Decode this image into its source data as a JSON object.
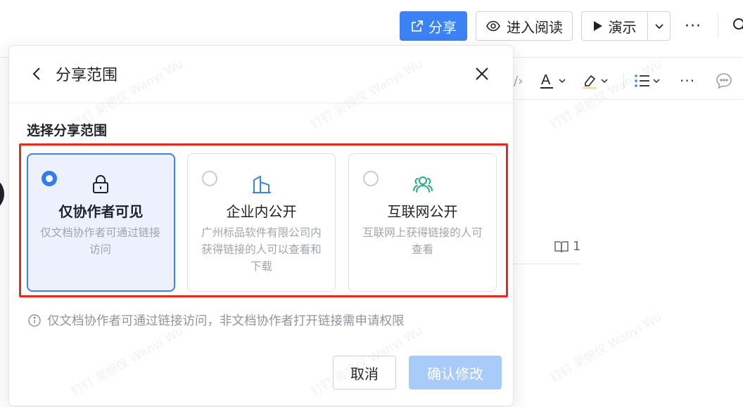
{
  "topbar": {
    "share_label": "分享",
    "read_label": "进入阅读",
    "present_label": "演示",
    "more_label": "···"
  },
  "format_toolbar": {
    "code_label": "/›",
    "font_color_letter": "A",
    "more_label": "···"
  },
  "doc_peek": {
    "book_count": "1"
  },
  "dialog": {
    "title": "分享范围",
    "section_label": "选择分享范围",
    "options": [
      {
        "title": "仅协作者可见",
        "description": "仅文档协作者可通过链接访问",
        "icon": "lock-icon",
        "selected": true
      },
      {
        "title": "企业内公开",
        "description": "广州标品软件有限公司内获得链接的人可以查看和下载",
        "icon": "building-icon",
        "selected": false
      },
      {
        "title": "互联网公开",
        "description": "互联网上获得链接的人可查看",
        "icon": "users-icon",
        "selected": false
      }
    ],
    "info_text": "仅文档协作者可通过链接访问，非文档协作者打开链接需申请权限",
    "cancel_label": "取消",
    "confirm_label": "确认修改"
  },
  "watermark_text": "钉钉 吴婉仪 Wanyi Wu",
  "colors": {
    "primary": "#3b82f6",
    "primary_disabled": "#a9cbfa",
    "selected_bg": "#ecf1fd",
    "highlight_red": "#ec2a1c",
    "internet_icon": "#22b07d"
  }
}
